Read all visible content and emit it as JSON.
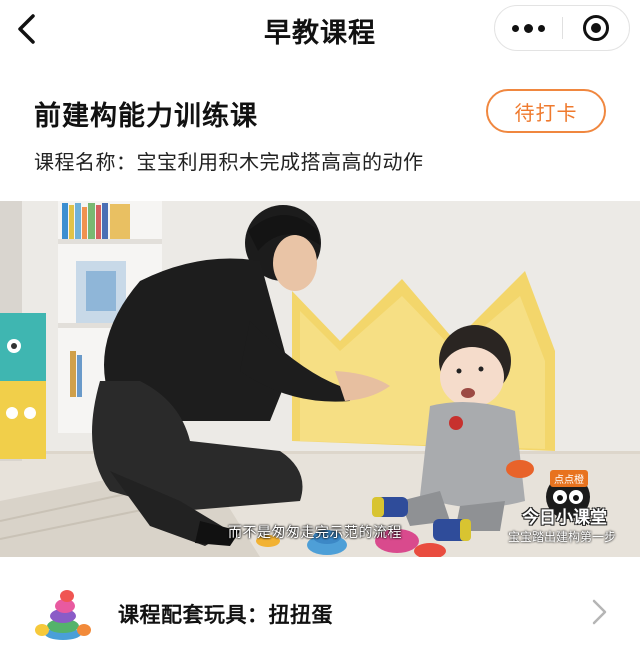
{
  "navbar": {
    "title": "早教课程",
    "back_icon": "chevron-left-icon",
    "more_icon": "more-dots-icon",
    "close_icon": "target-close-icon"
  },
  "course": {
    "title": "前建构能力训练课",
    "status_button": "待打卡",
    "name_line": "课程名称：宝宝利用积木完成搭高高的动作"
  },
  "video": {
    "subtitle": "而不是匆匆走完示范的流程",
    "brand_tag": "点点橙",
    "brand_name": "今日小课堂",
    "slogan": "宝宝踏出建构第一步"
  },
  "toy": {
    "label": "课程配套玩具：扭扭蛋",
    "icon": "stacking-toy-icon",
    "arrow_icon": "chevron-right-icon"
  },
  "colors": {
    "accent": "#ef7a2e",
    "text": "#111111",
    "scene_wall": "#ededeb",
    "pillow": "#f3d66b"
  }
}
